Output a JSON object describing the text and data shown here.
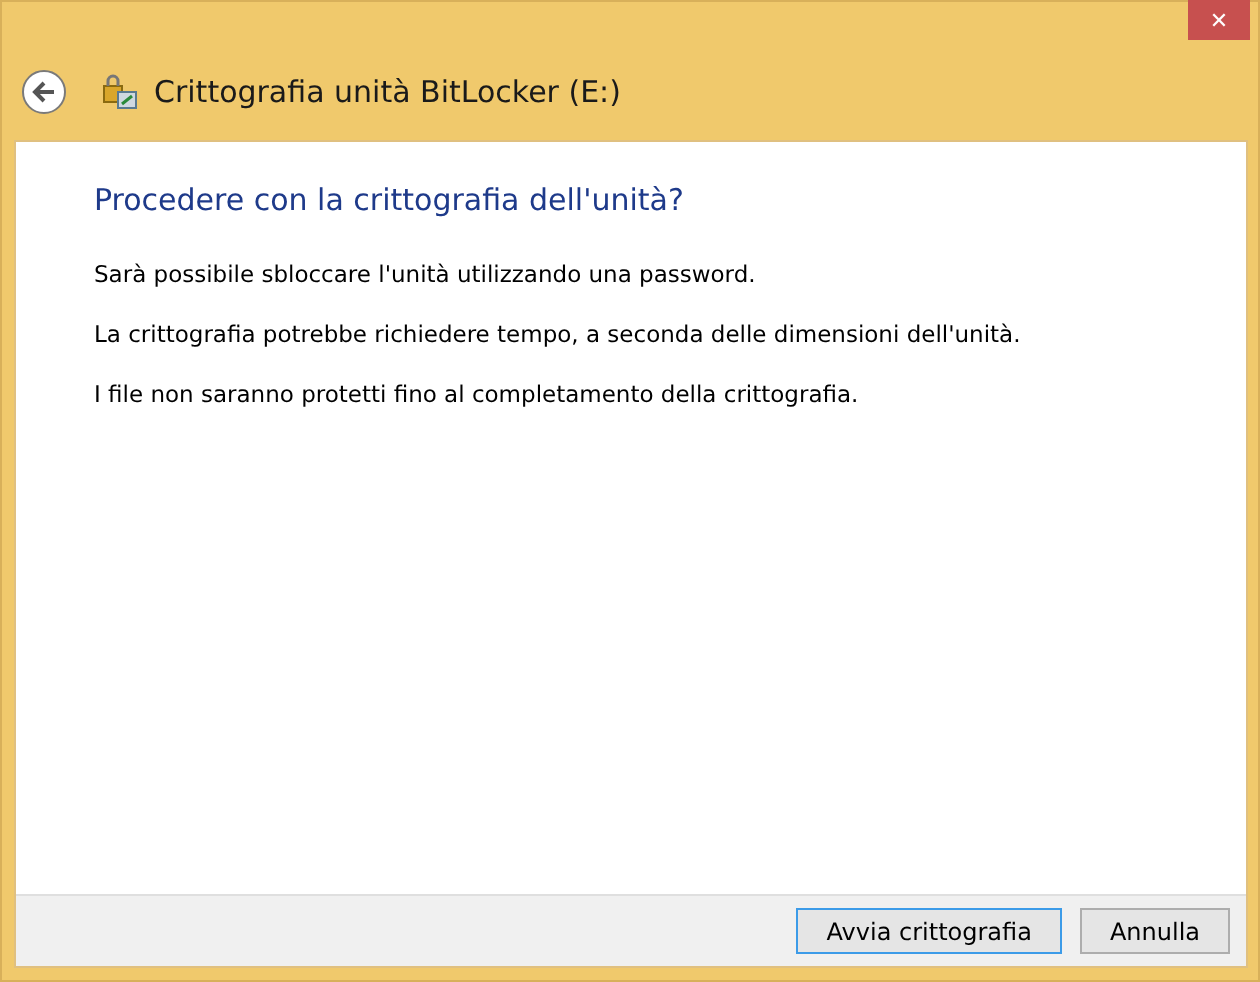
{
  "window": {
    "close_glyph": "✕",
    "title": "Crittografia unità BitLocker (E:)"
  },
  "heading": "Procedere con la crittografia dell'unità?",
  "paragraphs": [
    "Sarà possibile sbloccare l'unità utilizzando una password.",
    "La crittografia potrebbe richiedere tempo, a seconda delle dimensioni dell'unità.",
    "I file non saranno protetti fino al completamento della crittografia."
  ],
  "buttons": [
    {
      "label": "Avvia crittografia",
      "default": true
    },
    {
      "label": "Annulla",
      "default": false
    }
  ]
}
